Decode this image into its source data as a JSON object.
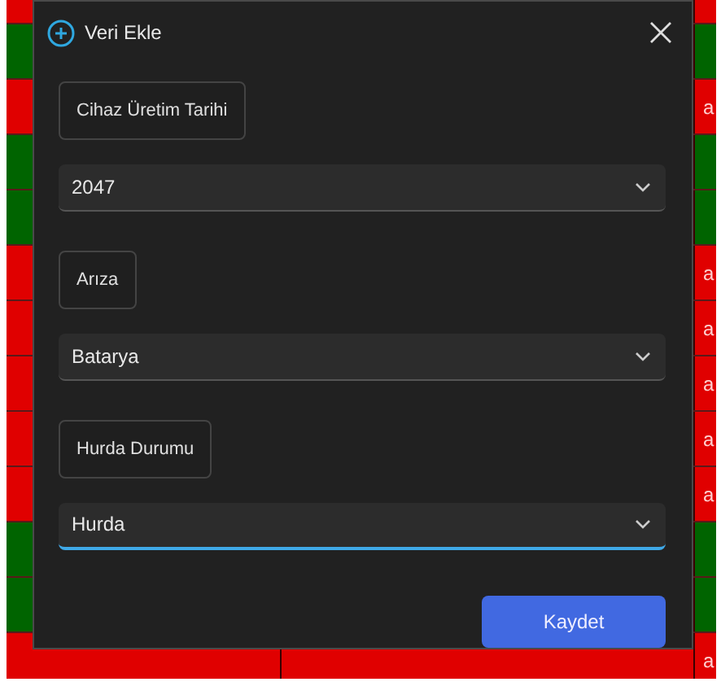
{
  "background_table": {
    "rows": [
      {
        "color": "#e00000"
      },
      {
        "color": "#006400"
      },
      {
        "color": "#e00000",
        "cell": "a"
      },
      {
        "color": "#006400"
      },
      {
        "color": "#006400"
      },
      {
        "color": "#e00000",
        "cell": "a"
      },
      {
        "color": "#e00000",
        "cell": "a"
      },
      {
        "color": "#e00000",
        "cell": "a"
      },
      {
        "color": "#e00000",
        "cell": "a"
      },
      {
        "color": "#e00000",
        "cell": "a"
      },
      {
        "color": "#006400"
      },
      {
        "color": "#006400"
      },
      {
        "color": "#e00000",
        "cell": "a"
      }
    ]
  },
  "dialog": {
    "title": "Veri Ekle",
    "fields": [
      {
        "label": "Cihaz Üretim Tarihi",
        "value": "2047",
        "focused": false
      },
      {
        "label": "Arıza",
        "value": "Batarya",
        "focused": false
      },
      {
        "label": "Hurda Durumu",
        "value": "Hurda",
        "focused": true
      }
    ],
    "save_button": "Kaydet"
  }
}
